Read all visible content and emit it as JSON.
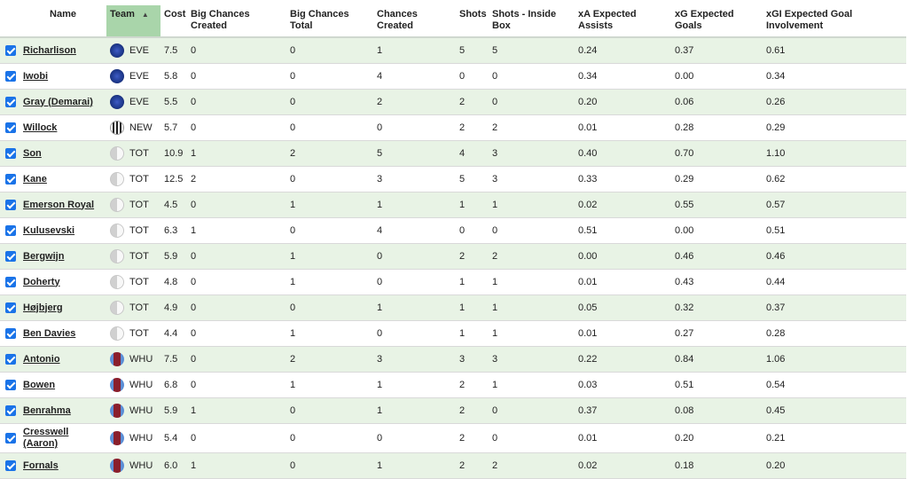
{
  "columns": {
    "name": "Name",
    "team": "Team",
    "team_sort_icon": "sort-ascending-icon",
    "cost": "Cost",
    "big_chances_created": "Big Chances Created",
    "big_chances_total": "Big Chances Total",
    "chances_created": "Chances Created",
    "shots": "Shots",
    "shots_inside_box": "Shots - Inside Box",
    "xa": "xA Expected Assists",
    "xg": "xG Expected Goals",
    "xgi": "xGI Expected Goal Involvement"
  },
  "colors": {
    "header_sorted": "#a9d5aa",
    "row_stripe": "#e8f3e5",
    "checkbox": "#1a73e8"
  },
  "rows": [
    {
      "checked": true,
      "name": "Richarlison",
      "team": "EVE",
      "cost": "7.5",
      "bcc": "0",
      "bct": "0",
      "cc": "1",
      "shots": "5",
      "sib": "5",
      "xa": "0.24",
      "xg": "0.37",
      "xgi": "0.61"
    },
    {
      "checked": true,
      "name": "Iwobi",
      "team": "EVE",
      "cost": "5.8",
      "bcc": "0",
      "bct": "0",
      "cc": "4",
      "shots": "0",
      "sib": "0",
      "xa": "0.34",
      "xg": "0.00",
      "xgi": "0.34"
    },
    {
      "checked": true,
      "name": "Gray (Demarai)",
      "team": "EVE",
      "cost": "5.5",
      "bcc": "0",
      "bct": "0",
      "cc": "2",
      "shots": "2",
      "sib": "0",
      "xa": "0.20",
      "xg": "0.06",
      "xgi": "0.26"
    },
    {
      "checked": true,
      "name": "Willock",
      "team": "NEW",
      "cost": "5.7",
      "bcc": "0",
      "bct": "0",
      "cc": "0",
      "shots": "2",
      "sib": "2",
      "xa": "0.01",
      "xg": "0.28",
      "xgi": "0.29"
    },
    {
      "checked": true,
      "name": "Son",
      "team": "TOT",
      "cost": "10.9",
      "bcc": "1",
      "bct": "2",
      "cc": "5",
      "shots": "4",
      "sib": "3",
      "xa": "0.40",
      "xg": "0.70",
      "xgi": "1.10"
    },
    {
      "checked": true,
      "name": "Kane",
      "team": "TOT",
      "cost": "12.5",
      "bcc": "2",
      "bct": "0",
      "cc": "3",
      "shots": "5",
      "sib": "3",
      "xa": "0.33",
      "xg": "0.29",
      "xgi": "0.62"
    },
    {
      "checked": true,
      "name": "Emerson Royal",
      "team": "TOT",
      "cost": "4.5",
      "bcc": "0",
      "bct": "1",
      "cc": "1",
      "shots": "1",
      "sib": "1",
      "xa": "0.02",
      "xg": "0.55",
      "xgi": "0.57"
    },
    {
      "checked": true,
      "name": "Kulusevski",
      "team": "TOT",
      "cost": "6.3",
      "bcc": "1",
      "bct": "0",
      "cc": "4",
      "shots": "0",
      "sib": "0",
      "xa": "0.51",
      "xg": "0.00",
      "xgi": "0.51"
    },
    {
      "checked": true,
      "name": "Bergwijn",
      "team": "TOT",
      "cost": "5.9",
      "bcc": "0",
      "bct": "1",
      "cc": "0",
      "shots": "2",
      "sib": "2",
      "xa": "0.00",
      "xg": "0.46",
      "xgi": "0.46"
    },
    {
      "checked": true,
      "name": "Doherty",
      "team": "TOT",
      "cost": "4.8",
      "bcc": "0",
      "bct": "1",
      "cc": "0",
      "shots": "1",
      "sib": "1",
      "xa": "0.01",
      "xg": "0.43",
      "xgi": "0.44"
    },
    {
      "checked": true,
      "name": "Højbjerg",
      "team": "TOT",
      "cost": "4.9",
      "bcc": "0",
      "bct": "0",
      "cc": "1",
      "shots": "1",
      "sib": "1",
      "xa": "0.05",
      "xg": "0.32",
      "xgi": "0.37"
    },
    {
      "checked": true,
      "name": "Ben Davies",
      "team": "TOT",
      "cost": "4.4",
      "bcc": "0",
      "bct": "1",
      "cc": "0",
      "shots": "1",
      "sib": "1",
      "xa": "0.01",
      "xg": "0.27",
      "xgi": "0.28"
    },
    {
      "checked": true,
      "name": "Antonio",
      "team": "WHU",
      "cost": "7.5",
      "bcc": "0",
      "bct": "2",
      "cc": "3",
      "shots": "3",
      "sib": "3",
      "xa": "0.22",
      "xg": "0.84",
      "xgi": "1.06"
    },
    {
      "checked": true,
      "name": "Bowen",
      "team": "WHU",
      "cost": "6.8",
      "bcc": "0",
      "bct": "1",
      "cc": "1",
      "shots": "2",
      "sib": "1",
      "xa": "0.03",
      "xg": "0.51",
      "xgi": "0.54"
    },
    {
      "checked": true,
      "name": "Benrahma",
      "team": "WHU",
      "cost": "5.9",
      "bcc": "1",
      "bct": "0",
      "cc": "1",
      "shots": "2",
      "sib": "0",
      "xa": "0.37",
      "xg": "0.08",
      "xgi": "0.45"
    },
    {
      "checked": true,
      "name": "Cresswell (Aaron)",
      "team": "WHU",
      "cost": "5.4",
      "bcc": "0",
      "bct": "0",
      "cc": "0",
      "shots": "2",
      "sib": "0",
      "xa": "0.01",
      "xg": "0.20",
      "xgi": "0.21"
    },
    {
      "checked": true,
      "name": "Fornals",
      "team": "WHU",
      "cost": "6.0",
      "bcc": "1",
      "bct": "0",
      "cc": "1",
      "shots": "2",
      "sib": "2",
      "xa": "0.02",
      "xg": "0.18",
      "xgi": "0.20"
    }
  ]
}
